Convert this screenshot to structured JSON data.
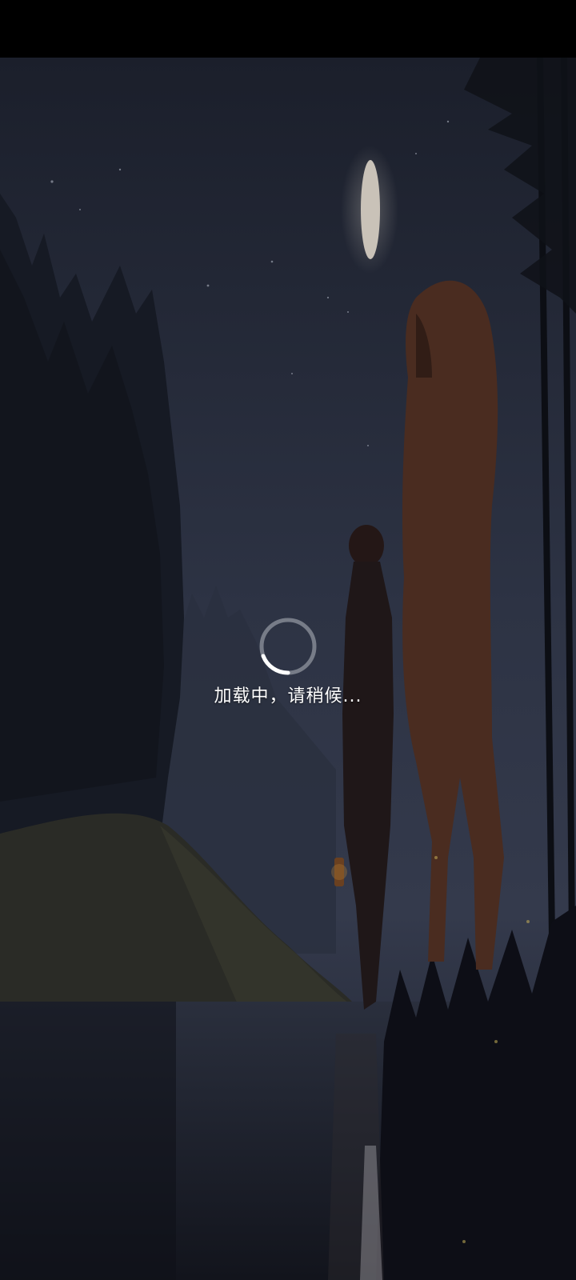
{
  "status_bar": {
    "color": "#000000"
  },
  "background": {
    "scene": "night-landscape-illustration",
    "sky_color": "#2b3140",
    "accent_moon": "#c9c2b8",
    "horse_color": "#4a2c20"
  },
  "loading": {
    "text": "加载中，请稍候...",
    "spinner_icon": "loading-spinner-icon",
    "spinner_color": "#ffffff",
    "spinner_track_color": "#8a8f98"
  }
}
